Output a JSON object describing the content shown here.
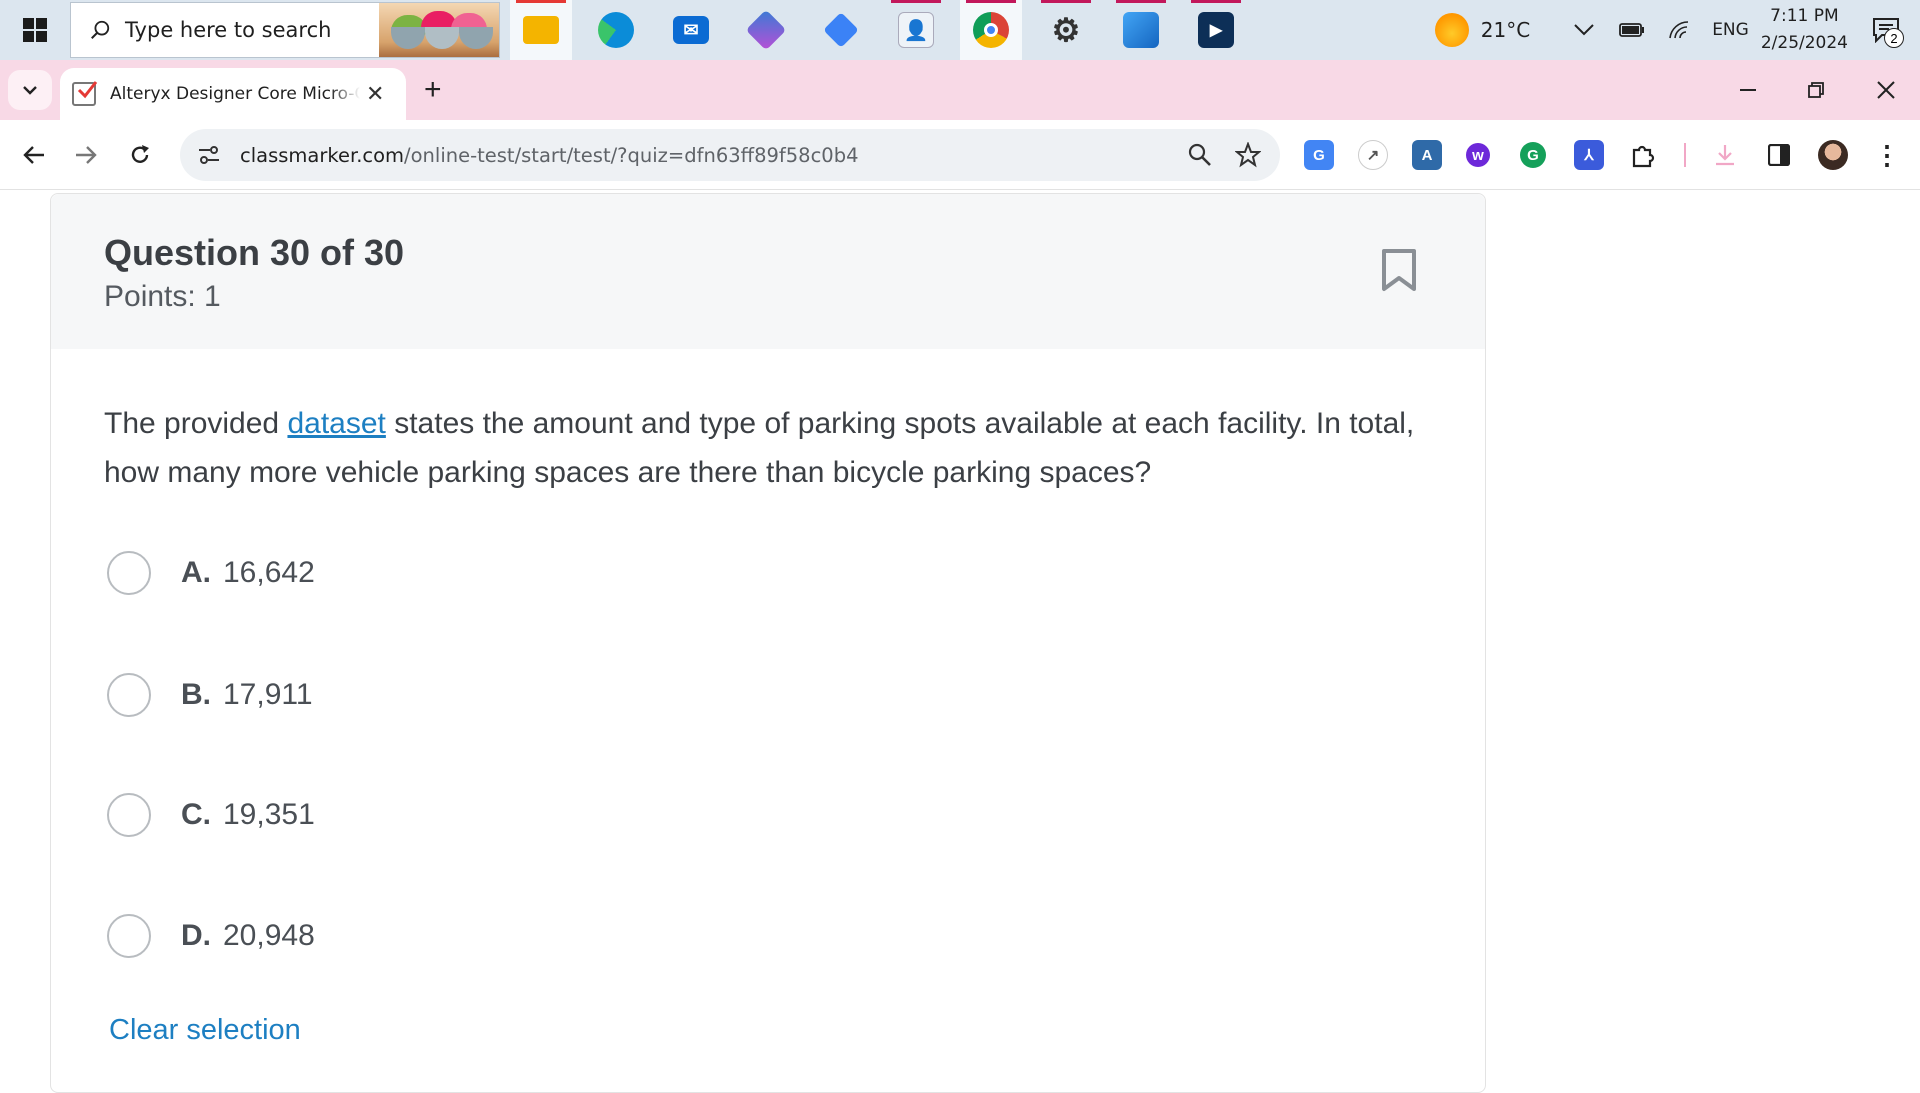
{
  "taskbar": {
    "search_placeholder": "Type here to search",
    "apps": [
      {
        "name": "file-explorer",
        "color": "#f4b400"
      },
      {
        "name": "edge",
        "color": "#0b8cd8"
      },
      {
        "name": "mail",
        "color": "#0b6bd3"
      },
      {
        "name": "copilot",
        "color": "#6b5bd6"
      },
      {
        "name": "app-diamond",
        "color": "#3b82f6"
      },
      {
        "name": "contacts",
        "color": "#5b8fd6"
      },
      {
        "name": "chrome",
        "color": "#db4437"
      },
      {
        "name": "settings",
        "color": "#444444"
      },
      {
        "name": "photos",
        "color": "#1e88e5"
      },
      {
        "name": "media-player",
        "color": "#0d2f57"
      }
    ],
    "weather_temp": "21°C",
    "language": "ENG",
    "time": "7:11 PM",
    "date": "2/25/2024",
    "notification_count": "2"
  },
  "browser": {
    "tab_title": "Alteryx Designer Core Micro-Credential",
    "new_tab_label": "+",
    "url_domain": "classmarker.com",
    "url_path": "/online-test/start/test/?quiz=dfn63ff89f58c0b4"
  },
  "question": {
    "title": "Question 30 of 30",
    "points": "Points: 1",
    "text_before_link": "The provided ",
    "link_text": "dataset",
    "text_after_link": " states the amount and type of parking spots available at each facility. In total, how many more vehicle parking spaces are there than bicycle parking spaces?",
    "options": [
      {
        "letter": "A.",
        "value": "16,642"
      },
      {
        "letter": "B.",
        "value": "17,911"
      },
      {
        "letter": "C.",
        "value": "19,351"
      },
      {
        "letter": "D.",
        "value": "20,948"
      }
    ],
    "clear_label": "Clear selection"
  }
}
